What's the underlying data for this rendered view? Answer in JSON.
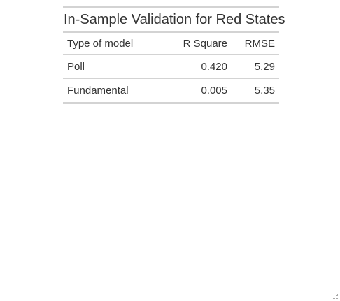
{
  "table": {
    "title": "In-Sample Validation for Red States",
    "columns": [
      "Type of model",
      "R Square",
      "RMSE"
    ],
    "rows": [
      {
        "model": "Poll",
        "r_square": "0.420",
        "rmse": "5.29"
      },
      {
        "model": "Fundamental",
        "r_square": "0.005",
        "rmse": "5.35"
      }
    ]
  },
  "icons": {
    "resize_grip": "resize-grip-icon"
  }
}
